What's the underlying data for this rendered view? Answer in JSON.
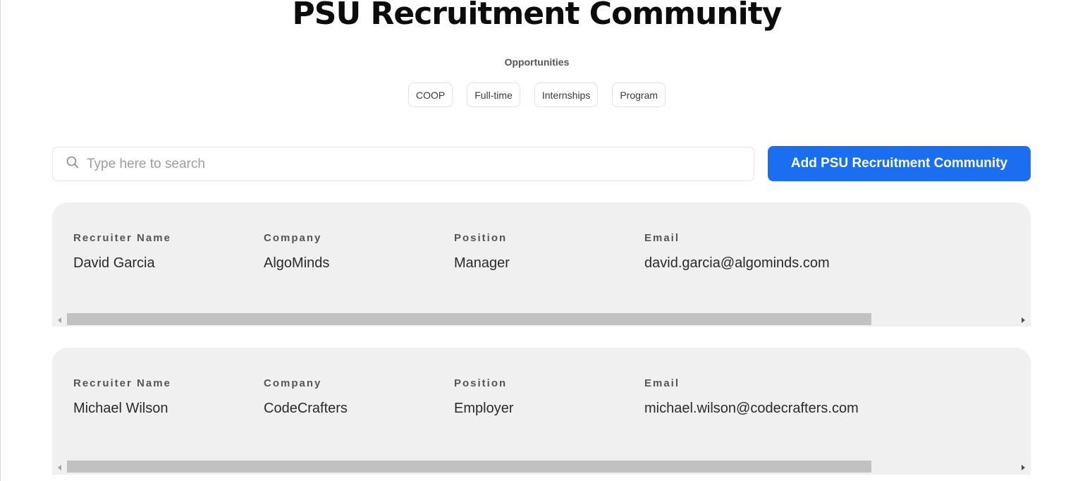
{
  "page": {
    "title": "PSU Recruitment Community",
    "subtitle": "Opportunities"
  },
  "filters": [
    {
      "label": "COOP"
    },
    {
      "label": "Full-time"
    },
    {
      "label": "Internships"
    },
    {
      "label": "Program"
    }
  ],
  "search": {
    "placeholder": "Type here to search",
    "value": "",
    "icon": "search-icon"
  },
  "actions": {
    "add_label": "Add PSU Recruitment Community",
    "add_color": "#1a6eef"
  },
  "columns": {
    "name": "Recruiter Name",
    "company": "Company",
    "position": "Position",
    "email": "Email"
  },
  "recruiters": [
    {
      "name": "David Garcia",
      "company": "AlgoMinds",
      "position": "Manager",
      "email": "david.garcia@algominds.com"
    },
    {
      "name": "Michael Wilson",
      "company": "CodeCrafters",
      "position": "Employer",
      "email": "michael.wilson@codecrafters.com"
    }
  ]
}
